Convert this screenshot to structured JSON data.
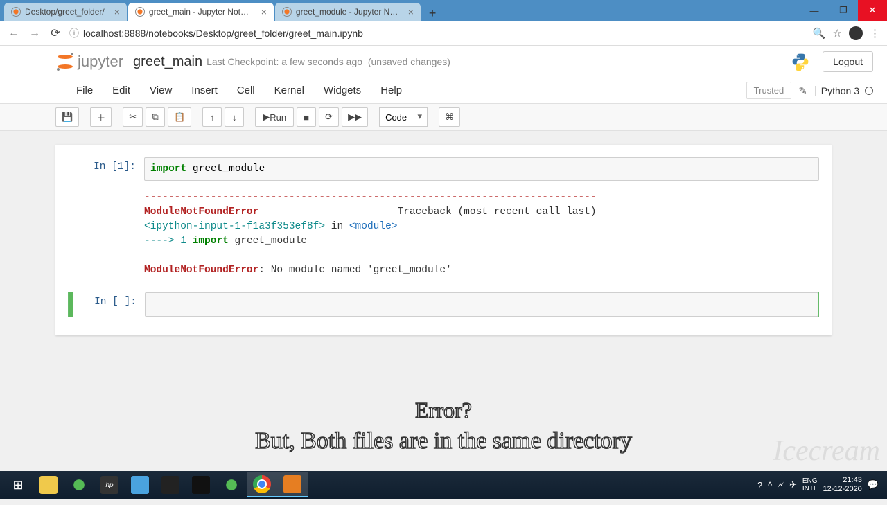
{
  "browser": {
    "tabs": [
      {
        "title": "Desktop/greet_folder/",
        "active": false
      },
      {
        "title": "greet_main - Jupyter Notebook",
        "active": true
      },
      {
        "title": "greet_module - Jupyter Notebo",
        "active": false
      }
    ],
    "url": "localhost:8888/notebooks/Desktop/greet_folder/greet_main.ipynb"
  },
  "jupyter": {
    "logo_text": "jupyter",
    "notebook_name": "greet_main",
    "checkpoint": "Last Checkpoint: a few seconds ago",
    "unsaved": "(unsaved changes)",
    "logout": "Logout",
    "menu": [
      "File",
      "Edit",
      "View",
      "Insert",
      "Cell",
      "Kernel",
      "Widgets",
      "Help"
    ],
    "trusted": "Trusted",
    "kernel": "Python 3",
    "run_label": "Run",
    "cell_type": "Code"
  },
  "cells": {
    "c1": {
      "prompt": "In [1]:",
      "code_kw": "import",
      "code_rest": " greet_module",
      "dashes": "---------------------------------------------------------------------------",
      "err_name1": "ModuleNotFoundError",
      "traceback_lbl": "Traceback (most recent call last)",
      "ipython_in": "<ipython-input-1-f1a3f353ef8f>",
      "in_word": " in ",
      "module_tag": "<module>",
      "arrow": "----> 1 ",
      "imp_kw": "import",
      "imp_rest": " greet_module",
      "err_name2": "ModuleNotFoundError",
      "err_msg": ": No module named 'greet_module'"
    },
    "c2": {
      "prompt": "In [ ]:"
    }
  },
  "caption": {
    "line1": "Error?",
    "line2": "But, Both files are in the same directory"
  },
  "watermark": "Icecream",
  "taskbar": {
    "lang": "ENG",
    "intl": "INTL",
    "time": "21:43",
    "date": "12-12-2020"
  }
}
